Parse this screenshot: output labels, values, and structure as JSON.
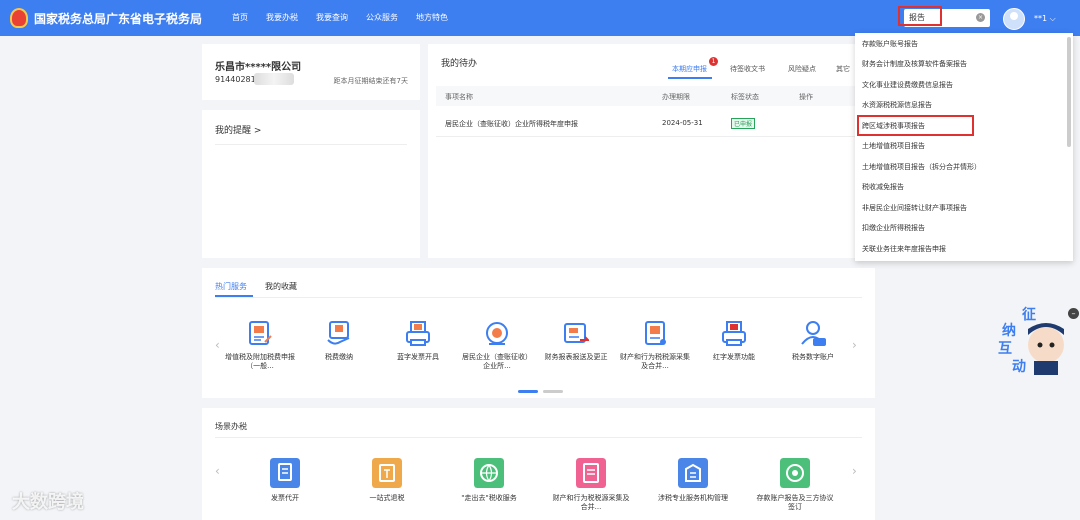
{
  "header": {
    "site_title": "国家税务总局广东省电子税务局",
    "nav": [
      "首页",
      "我要办税",
      "我要查询",
      "公众服务",
      "地方特色"
    ],
    "search_value": "报告",
    "user_label": "**1 ⌵"
  },
  "company": {
    "name": "乐昌市*****限公司",
    "tax_id": "914402810",
    "deadline_text": "距本月征期结束还有7天"
  },
  "reminder": {
    "title": "我的提醒 >"
  },
  "todo": {
    "title": "我的待办",
    "tabs": [
      "本期应申报",
      "待签收文书",
      "风险疑点",
      "其它"
    ],
    "badge_count": "1",
    "columns": [
      "事项名称",
      "办理期限",
      "标签状态",
      "操作"
    ],
    "rows": [
      {
        "name": "居民企业（查账征收）企业所得税年度申报",
        "deadline": "2024-05-31",
        "status": "已申报"
      }
    ]
  },
  "hot": {
    "tabs": [
      "热门服务",
      "我的收藏"
    ],
    "items": [
      {
        "label": "增值税及附加税费申报（一般...",
        "icon": "vat-icon"
      },
      {
        "label": "税费缴纳",
        "icon": "tax-payment-icon"
      },
      {
        "label": "蓝字发票开具",
        "icon": "blue-invoice-icon"
      },
      {
        "label": "居民企业（查账征收）企业所...",
        "icon": "enterprise-tax-icon"
      },
      {
        "label": "财务报表报送及更正",
        "icon": "financial-report-icon"
      },
      {
        "label": "财产和行为税税源采集及合并...",
        "icon": "property-tax-icon"
      },
      {
        "label": "红字发票功能",
        "icon": "red-invoice-icon"
      },
      {
        "label": "税务数字账户",
        "icon": "digital-account-icon"
      }
    ]
  },
  "scene": {
    "title": "场景办税",
    "items": [
      {
        "label": "发票代开",
        "icon": "invoice-agent-icon",
        "color": "#4a86e8"
      },
      {
        "label": "一站式退税",
        "icon": "refund-icon",
        "color": "#f0a94a"
      },
      {
        "label": "\"走出去\"税收服务",
        "icon": "tax-globe-icon",
        "color": "#4cc07a"
      },
      {
        "label": "财产和行为税税源采集及合并...",
        "icon": "property-scene-icon",
        "color": "#f06292"
      },
      {
        "label": "涉税专业服务机构管理",
        "icon": "agency-icon",
        "color": "#4a86e8"
      },
      {
        "label": "存款账户报告及三方协议签订",
        "icon": "bank-account-icon",
        "color": "#4cc07a"
      }
    ]
  },
  "dropdown": {
    "items": [
      "存款账户账号报告",
      "财务会计制度及核算软件备案报告",
      "文化事业建设费缴费信息报告",
      "水资源税税源信息报告",
      "跨区域涉税事项报告",
      "土地增值税项目报告",
      "土地增值税项目报告（拆分合并情形）",
      "税收减免报告",
      "非居民企业间接转让财产事项报告",
      "扣缴企业所得税报告",
      "关联业务往来年度报告申报"
    ]
  },
  "mascot": {
    "text": [
      "征",
      "纳",
      "互",
      "动"
    ]
  },
  "watermark": "大数跨境",
  "colors": {
    "brand": "#3d7ef0",
    "highlight": "#e03131",
    "success": "#27a35a"
  }
}
